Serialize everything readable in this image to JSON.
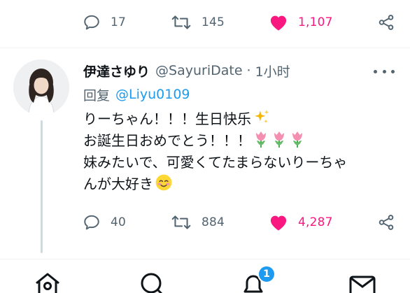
{
  "previous_tweet": {
    "actions": {
      "reply_count": "17",
      "retweet_count": "145",
      "like_count": "1,107"
    }
  },
  "tweet": {
    "display_name": "伊達さゆり",
    "handle": "@SayuriDate",
    "separator": "·",
    "time": "1小时",
    "reply_label": "回复",
    "reply_mention": "@Liyu0109",
    "lines": [
      "りーちゃん！！！生日快乐",
      "お誕生日おめでとう！！！",
      "妹みたいで、可愛くてたまらないりーちゃ",
      "んが大好き"
    ],
    "actions": {
      "reply_count": "40",
      "retweet_count": "884",
      "like_count": "4,287"
    }
  },
  "tab_bar": {
    "notifications_badge": "1"
  },
  "colors": {
    "like": "#f91880",
    "link": "#1d9bf0",
    "secondary": "#536471",
    "thread_line": "#cfd9de"
  }
}
